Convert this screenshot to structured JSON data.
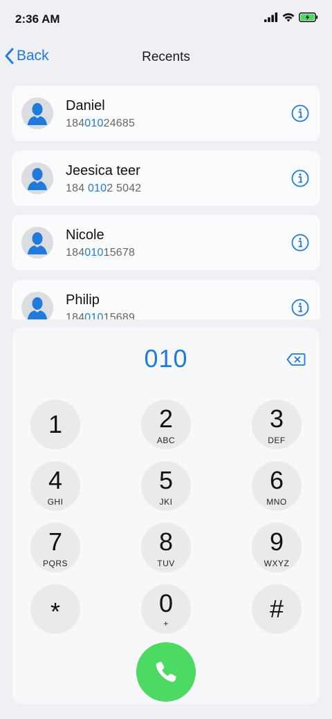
{
  "status": {
    "time": "2:36 AM"
  },
  "nav": {
    "back_label": "Back",
    "title": "Recents"
  },
  "contacts": [
    {
      "name": "Daniel",
      "number_pre": "184",
      "number_hl": "010",
      "number_post": "24685"
    },
    {
      "name": "Jeesica teer",
      "number_pre": "184 ",
      "number_hl": "010",
      "number_post": "2 5042"
    },
    {
      "name": "Nicole",
      "number_pre": "184",
      "number_hl": "010",
      "number_post": "15678"
    },
    {
      "name": "Philip",
      "number_pre": "184",
      "number_hl": "010",
      "number_post": "15689"
    }
  ],
  "dialer": {
    "display": "010",
    "keys": [
      {
        "digit": "1",
        "letters": ""
      },
      {
        "digit": "2",
        "letters": "ABC"
      },
      {
        "digit": "3",
        "letters": "DEF"
      },
      {
        "digit": "4",
        "letters": "GHI"
      },
      {
        "digit": "5",
        "letters": "JKI"
      },
      {
        "digit": "6",
        "letters": "MNO"
      },
      {
        "digit": "7",
        "letters": "PQRS"
      },
      {
        "digit": "8",
        "letters": "TUV"
      },
      {
        "digit": "9",
        "letters": "WXYZ"
      },
      {
        "digit": "*",
        "letters": ""
      },
      {
        "digit": "0",
        "letters": "+"
      },
      {
        "digit": "#",
        "letters": ""
      }
    ]
  },
  "icons": {
    "back": "chevron-left-icon",
    "info": "info-circle-icon",
    "avatar": "person-silhouette-icon",
    "backspace": "backspace-icon",
    "call": "phone-icon",
    "signal": "cellular-signal-icon",
    "wifi": "wifi-icon",
    "battery": "battery-charging-icon"
  },
  "colors": {
    "accent": "#1f7ad9",
    "call": "#4cd964",
    "key_bg": "#e9eaec",
    "battery": "#4cd964"
  }
}
